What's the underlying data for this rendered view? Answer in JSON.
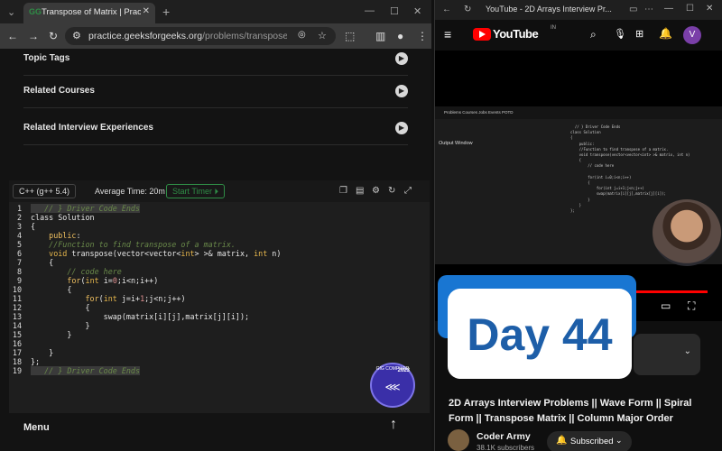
{
  "left_browser": {
    "tab_title": "Transpose of Matrix | Practice |",
    "url_host": "practice.geeksforgeeks.org",
    "url_path": "/problems/transpose-of-matri..."
  },
  "accordion": [
    {
      "label": "Topic Tags"
    },
    {
      "label": "Related Courses"
    },
    {
      "label": "Related Interview Experiences"
    }
  ],
  "editor": {
    "language": "C++ (g++ 5.4)",
    "avg_time": "Average Time: 20m",
    "timer_label": "Start Timer",
    "lines": [
      {
        "n": "1",
        "html": "<span class=\"hl cm\">   // } Driver Code Ends</span>"
      },
      {
        "n": "2",
        "html": "class Solution"
      },
      {
        "n": "3",
        "html": "{"
      },
      {
        "n": "4",
        "html": "    <span class=\"kw\">public</span>:"
      },
      {
        "n": "5",
        "html": "    <span class=\"cm\">//Function to find transpose of a matrix.</span>"
      },
      {
        "n": "6",
        "html": "    <span class=\"ty\">void</span> transpose(vector&lt;vector&lt;<span class=\"ty\">int</span>&gt; &gt;&amp; matrix, <span class=\"ty\">int</span> n)"
      },
      {
        "n": "7",
        "html": "    {"
      },
      {
        "n": "8",
        "html": "        <span class=\"cm\">// code here</span>"
      },
      {
        "n": "9",
        "html": "        <span class=\"kw\">for</span>(<span class=\"ty\">int</span> i=<span class=\"num\">0</span>;i&lt;n;i++)"
      },
      {
        "n": "10",
        "html": "        {"
      },
      {
        "n": "11",
        "html": "            <span class=\"kw\">for</span>(<span class=\"ty\">int</span> j=i+<span class=\"num\">1</span>;j&lt;n;j++)"
      },
      {
        "n": "12",
        "html": "            {"
      },
      {
        "n": "13",
        "html": "                swap(matrix[i][j],matrix[j][i]);"
      },
      {
        "n": "14",
        "html": "            }"
      },
      {
        "n": "15",
        "html": "        }"
      },
      {
        "n": "16",
        "html": ""
      },
      {
        "n": "17",
        "html": "    }"
      },
      {
        "n": "18",
        "html": "};"
      },
      {
        "n": "19",
        "html": "<span class=\"hl cm\">   // } Driver Code Ends</span>"
      }
    ]
  },
  "badge": {
    "text": "GfG COMPILED",
    "year": "2023"
  },
  "left_footer": {
    "menu": "Menu"
  },
  "right_browser": {
    "tab_title": "YouTube - 2D Arrays Interview Pr...",
    "logo_word": "YouTube",
    "logo_country": "IN",
    "avatar_letter": "V"
  },
  "video_screenshot": {
    "nav": "Problems   Courses   Jobs   Events   POTD",
    "output_window": "Output Window",
    "mini_code": "  // } Driver Code Ends\nclass Solution\n{\n    public:\n    //Function to find transpose of a matrix.\n    void transpose(vector<vector<int> >& matrix, int n)\n    {\n        // code here\n\n        for(int i=0;i<n;i++)\n        {\n            for(int j=i+1;j<n;j++)\n            swap(matrix[i][j],matrix[j][i]);\n        }\n    }\n};"
  },
  "thumbnail": {
    "text": "Day 44"
  },
  "video": {
    "title": "2D Arrays Interview Problems || Wave Form || Spiral Form || Transpose Matrix || Column Major Order",
    "channel": "Coder Army",
    "subscribers": "38.1K subscribers",
    "subscribe_label": "Subscribed"
  }
}
